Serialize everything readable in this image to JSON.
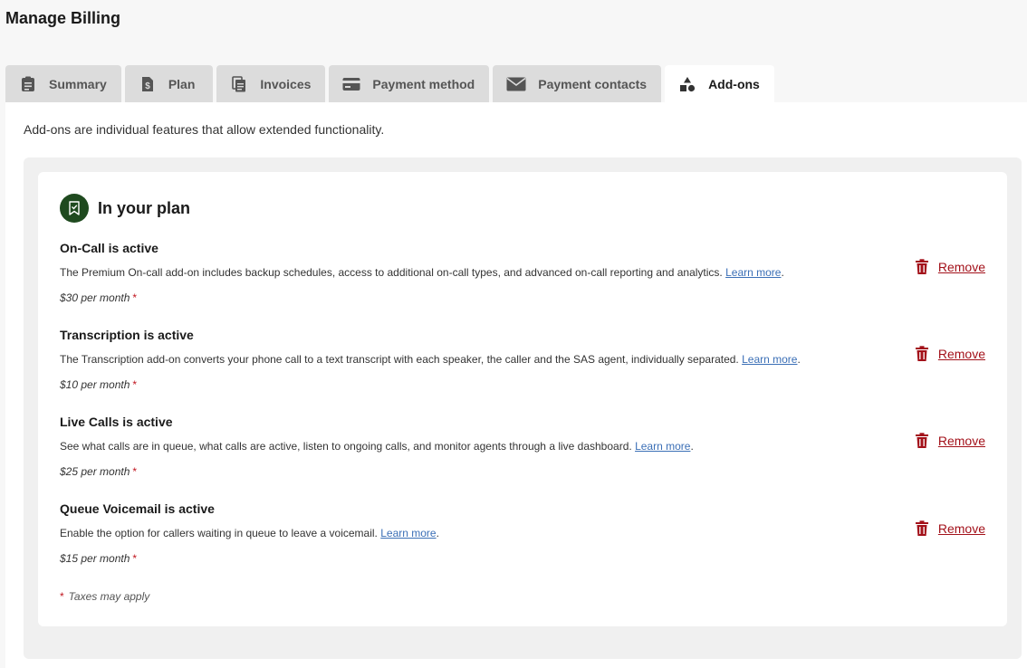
{
  "page": {
    "title": "Manage Billing"
  },
  "tabs": [
    {
      "label": "Summary",
      "icon": "clipboard-list-icon"
    },
    {
      "label": "Plan",
      "icon": "dollar-document-icon"
    },
    {
      "label": "Invoices",
      "icon": "documents-icon"
    },
    {
      "label": "Payment method",
      "icon": "credit-card-icon"
    },
    {
      "label": "Payment contacts",
      "icon": "envelope-icon"
    },
    {
      "label": "Add-ons",
      "icon": "shapes-icon",
      "active": true
    }
  ],
  "intro": "Add-ons are individual features that allow extended functionality.",
  "plan_card": {
    "title": "In your plan",
    "icon": "bookmark-check-icon",
    "remove_label": "Remove",
    "learn_more": "Learn more",
    "addons": [
      {
        "title": "On-Call is active",
        "description": "The Premium On-call add-on includes backup schedules, access to additional on-call types, and advanced on-call reporting and analytics.",
        "price": "$30 per month"
      },
      {
        "title": "Transcription is active",
        "description": "The Transcription add-on converts your phone call to a text transcript with each speaker, the caller and the SAS agent, individually separated.",
        "price": "$10 per month"
      },
      {
        "title": "Live Calls is active",
        "description": "See what calls are in queue, what calls are active, listen to ongoing calls, and monitor agents through a live dashboard.",
        "price": "$25 per month"
      },
      {
        "title": "Queue Voicemail is active",
        "description": "Enable the option for callers waiting in queue to leave a voicemail.",
        "price": "$15 per month"
      }
    ],
    "asterisk": "*",
    "tax_note": "Taxes may apply"
  },
  "colors": {
    "accent_green": "#1f4a1f",
    "remove_red": "#a3111a",
    "link_blue": "#3b6fb6"
  }
}
